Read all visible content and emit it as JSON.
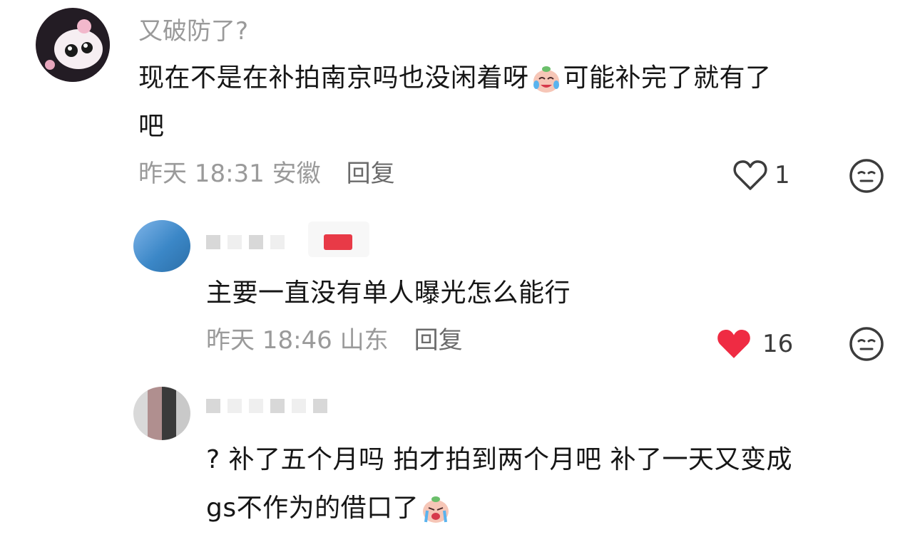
{
  "comments": [
    {
      "username": "又破防了?",
      "text_line1": "现在不是在补拍南京吗也没闲着呀",
      "text_line1_tail": "可能补完了就有了",
      "text_line2": "吧",
      "time": "昨天 18:31",
      "location": "安徽",
      "reply_label": "回复",
      "like_count": "1",
      "liked": false
    },
    {
      "text": "主要一直没有单人曝光怎么能行",
      "time": "昨天 18:46",
      "location": "山东",
      "reply_label": "回复",
      "like_count": "16",
      "liked": true
    },
    {
      "text_line1": "? 补了五个月吗 拍才拍到两个月吧 补了一天又变成",
      "text_line2": "gs不作为的借口了"
    }
  ],
  "colors": {
    "like_active": "#ef2b43",
    "meta_gray": "#9a9a9a"
  },
  "icons": [
    "heart-outline-icon",
    "heart-filled-icon",
    "face-emoji-icon",
    "crying-laughing-emoji"
  ]
}
